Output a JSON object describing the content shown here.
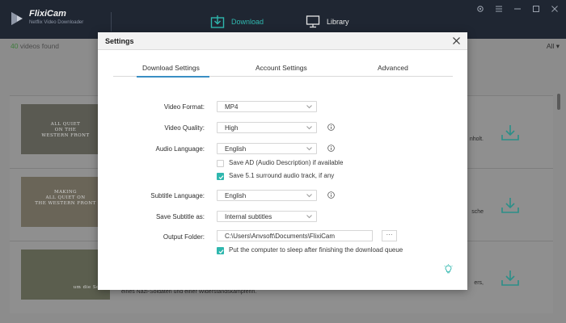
{
  "app": {
    "name": "FlixiCam",
    "subtitle": "Netflix Video Downloader"
  },
  "nav": {
    "download": "Download",
    "library": "Library"
  },
  "list": {
    "count": "40",
    "count_suffix": " videos found",
    "filter": "All",
    "rows": [
      {
        "thumb_text": [
          "ALL QUIET",
          "ON THE",
          "WESTERN FRONT"
        ],
        "desc_tail": "nholt."
      },
      {
        "thumb_text": [
          "MAKING",
          "ALL QUIET ON",
          "THE WESTERN FRONT"
        ],
        "desc_tail": "sche"
      },
      {
        "thumb_text": [
          "um die Schw"
        ],
        "desc_tail": "ers,",
        "desc_line": "eines Nazi-Soldaten und einer Widerstandskämpferin."
      }
    ]
  },
  "settings": {
    "title": "Settings",
    "tabs": [
      "Download Settings",
      "Account Settings",
      "Advanced"
    ],
    "active_tab": "Download Settings",
    "video_format": {
      "label": "Video Format:",
      "value": "MP4"
    },
    "video_quality": {
      "label": "Video Quality:",
      "value": "High"
    },
    "audio_language": {
      "label": "Audio Language:",
      "value": "English"
    },
    "save_ad": {
      "label": "Save AD (Audio Description) if available",
      "checked": false
    },
    "save_51": {
      "label": "Save 5.1 surround audio track, if any",
      "checked": true
    },
    "subtitle_language": {
      "label": "Subtitle Language:",
      "value": "English"
    },
    "save_subtitle": {
      "label": "Save Subtitle as:",
      "value": "Internal subtitles"
    },
    "output_folder": {
      "label": "Output Folder:",
      "value": "C:\\Users\\Anvsoft\\Documents\\FlixiCam",
      "browse": "···"
    },
    "sleep": {
      "label": "Put the computer to sleep after finishing the download queue",
      "checked": true
    }
  },
  "colors": {
    "accent": "#2fb7ae",
    "titlebar": "#1f2632",
    "tab_underline": "#3a8fc4"
  },
  "icons": [
    "logo-icon",
    "download-nav-icon",
    "library-nav-icon",
    "settings-icon",
    "menu-icon",
    "minimize-icon",
    "maximize-icon",
    "close-icon",
    "download-icon",
    "info-icon",
    "chevron-down-icon",
    "bulb-icon"
  ]
}
